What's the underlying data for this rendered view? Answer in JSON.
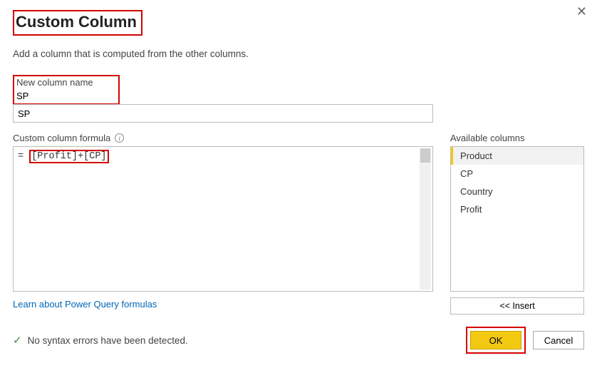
{
  "dialog": {
    "title": "Custom Column",
    "subtitle": "Add a column that is computed from the other columns.",
    "close_glyph": "✕"
  },
  "name": {
    "label": "New column name",
    "value": "SP"
  },
  "formula": {
    "label": "Custom column formula",
    "prefix": "= ",
    "value": "[Profit]+[CP]"
  },
  "available": {
    "label": "Available columns",
    "items": [
      "Product",
      "CP",
      "Country",
      "Profit"
    ],
    "selected_index": 0,
    "insert_label": "<< Insert"
  },
  "learn_link": "Learn about Power Query formulas",
  "status": {
    "ok_glyph": "✓",
    "text": "No syntax errors have been detected."
  },
  "buttons": {
    "ok": "OK",
    "cancel": "Cancel"
  }
}
